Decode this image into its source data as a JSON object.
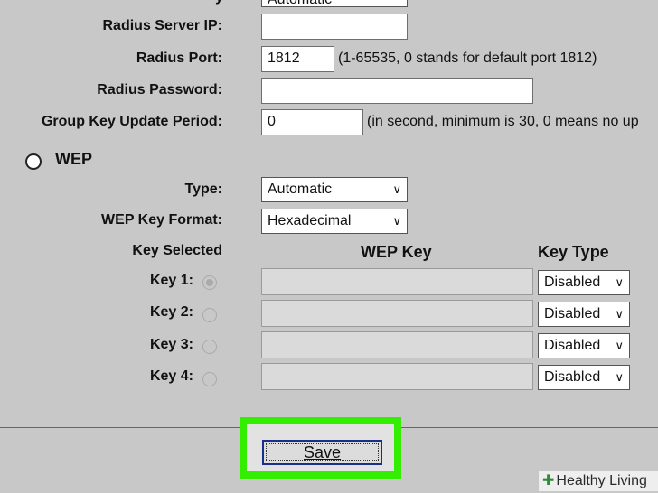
{
  "fields": {
    "partial_select_value": "Automatic",
    "radius_server_ip": {
      "label": "Radius Server IP:",
      "value": ""
    },
    "radius_port": {
      "label": "Radius Port:",
      "value": "1812",
      "note": "(1-65535, 0 stands for default port 1812)"
    },
    "radius_password": {
      "label": "Radius Password:",
      "value": ""
    },
    "group_key_update": {
      "label": "Group Key Update Period:",
      "value": "0",
      "note": "(in second, minimum is 30, 0 means no up"
    }
  },
  "wep": {
    "title": "WEP",
    "type": {
      "label": "Type:",
      "value": "Automatic"
    },
    "key_format": {
      "label": "WEP Key Format:",
      "value": "Hexadecimal"
    },
    "headers": {
      "key_selected": "Key Selected",
      "wep_key": "WEP Key",
      "key_type": "Key Type"
    },
    "keys": [
      {
        "label": "Key 1:",
        "value": "",
        "type": "Disabled",
        "selected": true
      },
      {
        "label": "Key 2:",
        "value": "",
        "type": "Disabled",
        "selected": false
      },
      {
        "label": "Key 3:",
        "value": "",
        "type": "Disabled",
        "selected": false
      },
      {
        "label": "Key 4:",
        "value": "",
        "type": "Disabled",
        "selected": false
      }
    ]
  },
  "save_label": "Save",
  "watermark": "Healthy Living",
  "colors": {
    "highlight": "#33ee00",
    "background": "#c8c8c8"
  }
}
